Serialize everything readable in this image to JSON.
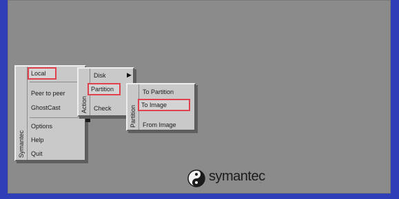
{
  "main_menu": {
    "strip_label": "Symantec",
    "items": [
      "Local",
      "Peer to peer",
      "GhostCast",
      "Options",
      "Help",
      "Quit"
    ]
  },
  "action_menu": {
    "strip_label": "Action",
    "items": [
      "Disk",
      "Partition",
      "Check"
    ]
  },
  "partition_menu": {
    "strip_label": "Partition",
    "items": [
      "To Partition",
      "To Image",
      "From Image"
    ]
  },
  "brand": {
    "name": "symantec"
  },
  "icons": {
    "submenu": "triangle-right-icon",
    "logo": "yin-yang-logo"
  }
}
